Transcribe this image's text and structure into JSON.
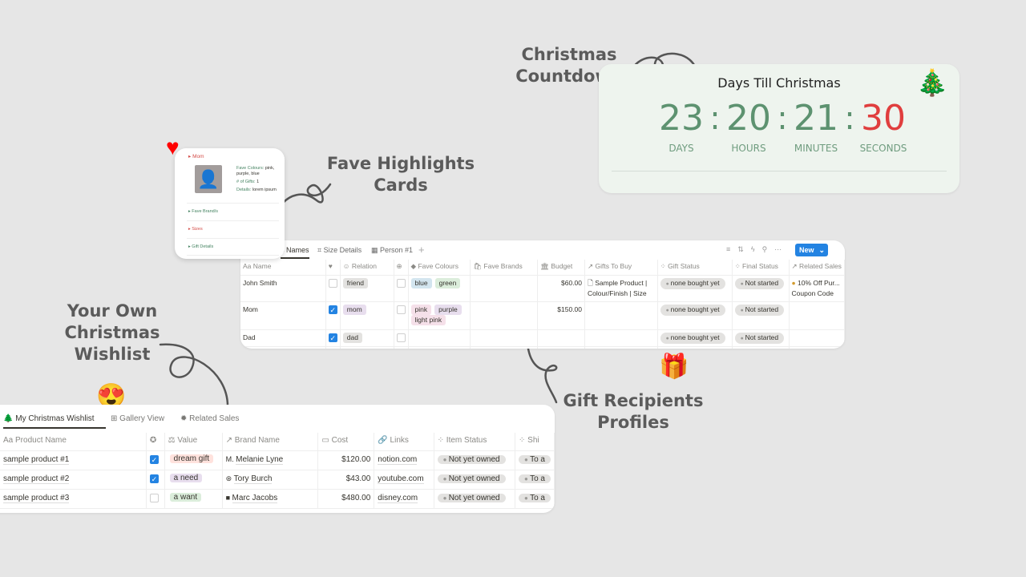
{
  "labels": {
    "countdown": [
      "Christmas",
      "Countdown"
    ],
    "highlights": [
      "Fave Highlights",
      "Cards"
    ],
    "recipients": [
      "Gift Recipients",
      "Profiles"
    ],
    "wishlist": [
      "Your Own",
      "Christmas",
      "Wishlist"
    ]
  },
  "countdown": {
    "title": "Days Till Christmas",
    "units": [
      {
        "value": "23",
        "label": "DAYS"
      },
      {
        "value": "20",
        "label": "HOURS"
      },
      {
        "value": "21",
        "label": "MINUTES"
      },
      {
        "value": "30",
        "label": "SECONDS"
      }
    ],
    "accent": "#5d9270",
    "seconds_color": "#e03e3e",
    "icon": "christmas-tree-icon"
  },
  "highlight_card": {
    "name": "Mom",
    "fave_colours_label": "Fave Colours:",
    "fave_colours": "pink, purple, blue",
    "gifts_label": "# of Gifts:",
    "gifts": "1",
    "details_label": "Details:",
    "details": "lorem ipsum",
    "sections": [
      "Fave Brand/s",
      "Sizes",
      "Gift Details"
    ]
  },
  "recipients": {
    "tabs": [
      "s Names",
      "Size Details",
      "Person #1"
    ],
    "new_label": "New",
    "columns": [
      "Name",
      "",
      "Relation",
      "",
      "Fave Colours",
      "Fave Brands",
      "Budget",
      "Gifts To Buy",
      "Gift Status",
      "Final Status",
      "Related Sales"
    ],
    "rows": [
      {
        "name": "John Smith",
        "fav": false,
        "relation": "friend",
        "c2": false,
        "colours": [
          "blue",
          "green"
        ],
        "budget": "$60.00",
        "gifts": "Sample Product | Colour/Finish | Size",
        "gift_status": "none bought yet",
        "final_status": "Not started",
        "sales": "10% Off Pur... Coupon Code"
      },
      {
        "name": "Mom",
        "fav": true,
        "relation": "mom",
        "c2": false,
        "colours": [
          "pink",
          "purple",
          "light pink"
        ],
        "budget": "$150.00",
        "gifts": "",
        "gift_status": "none bought yet",
        "final_status": "Not started",
        "sales": ""
      },
      {
        "name": "Dad",
        "fav": true,
        "relation": "dad",
        "c2": false,
        "colours": [],
        "budget": "",
        "gifts": "",
        "gift_status": "none bought yet",
        "final_status": "Not started",
        "sales": ""
      }
    ]
  },
  "wishlist": {
    "tabs": [
      "My Christmas Wishlist",
      "Gallery View",
      "Related Sales"
    ],
    "columns": [
      "Product Name",
      "",
      "Value",
      "Brand Name",
      "Cost",
      "Links",
      "Item Status",
      "Shi"
    ],
    "rows": [
      {
        "name": "sample product #1",
        "checked": true,
        "value": "dream gift",
        "brand": "Melanie Lyne",
        "cost": "$120.00",
        "link": "notion.com",
        "status": "Not yet owned",
        "ship": "To a"
      },
      {
        "name": "sample product #2",
        "checked": true,
        "value": "a need",
        "brand": "Tory Burch",
        "cost": "$43.00",
        "link": "youtube.com",
        "status": "Not yet owned",
        "ship": "To a"
      },
      {
        "name": "sample product #3",
        "checked": false,
        "value": "a want",
        "brand": "Marc Jacobs",
        "cost": "$480.00",
        "link": "disney.com",
        "status": "Not yet owned",
        "ship": "To a"
      }
    ]
  },
  "tag_colors": {
    "friend": "#e3e2e0",
    "mom": "#e8deee",
    "dad": "#e3e2e0",
    "blue": "#d3e5ef",
    "green": "#dbeddb",
    "pink": "#f5e0e9",
    "purple": "#e8deee",
    "light pink": "#f5e0e9",
    "dream gift": "#ffe2dd",
    "a need": "#e8deee",
    "a want": "#dbeddb"
  }
}
